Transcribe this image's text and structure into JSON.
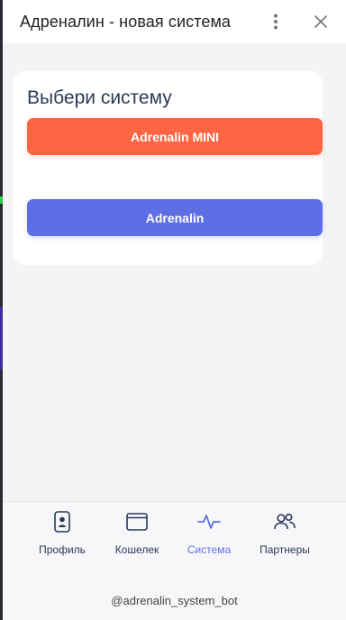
{
  "header": {
    "title": "Адреналин - новая система",
    "menu_icon": "more-vertical-icon",
    "close_icon": "close-icon"
  },
  "card": {
    "title": "Выбери систему",
    "buttons": [
      {
        "label": "Adrenalin MINI",
        "color": "#ff6542"
      },
      {
        "label": "Adrenalin",
        "color": "#5e6fe6"
      }
    ]
  },
  "nav": {
    "items": [
      {
        "label": "Профиль",
        "icon": "profile-phone-icon",
        "active": false
      },
      {
        "label": "Кошелек",
        "icon": "wallet-icon",
        "active": false
      },
      {
        "label": "Система",
        "icon": "activity-icon",
        "active": true
      },
      {
        "label": "Партнеры",
        "icon": "partners-icon",
        "active": false
      }
    ],
    "bot_handle": "@adrenalin_system_bot"
  },
  "colors": {
    "accent": "#5e6fe6",
    "mini": "#ff6542",
    "text_dark": "#2b3858"
  }
}
